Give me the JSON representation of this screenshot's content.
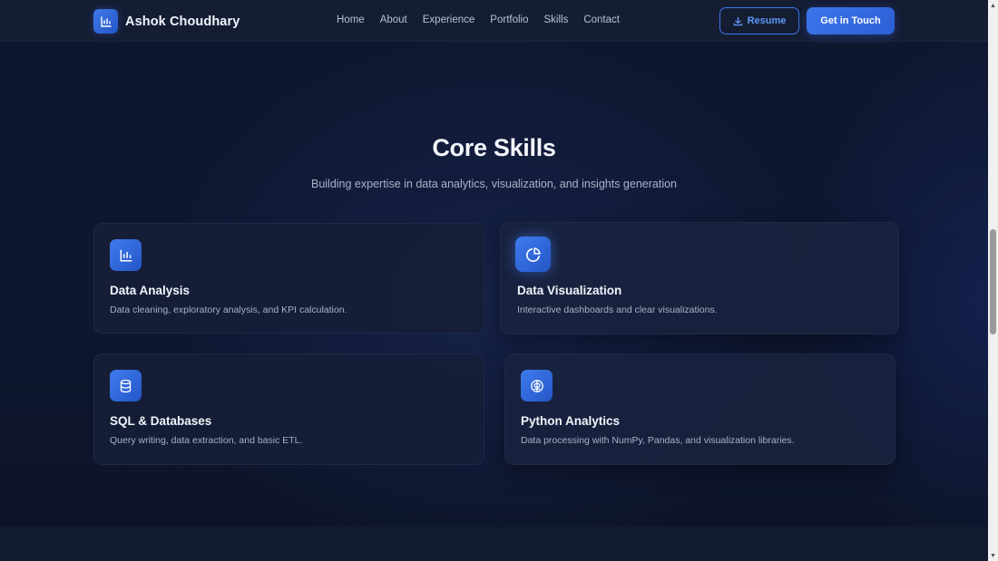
{
  "navbar": {
    "brand_name": "Ashok Choudhary",
    "links": [
      "Home",
      "About",
      "Experience",
      "Portfolio",
      "Skills",
      "Contact"
    ],
    "resume_label": "Resume",
    "touch_label": "Get in Touch"
  },
  "skills": {
    "title": "Core Skills",
    "subtitle": "Building expertise in data analytics, visualization, and insights generation",
    "cards": [
      {
        "title": "Data Analysis",
        "desc": "Data cleaning, exploratory analysis, and KPI calculation.",
        "icon": "bar-chart-icon"
      },
      {
        "title": "Data Visualization",
        "desc": "Interactive dashboards and clear visualizations.",
        "icon": "pie-chart-icon"
      },
      {
        "title": "SQL & Databases",
        "desc": "Query writing, data extraction, and basic ETL.",
        "icon": "database-icon"
      },
      {
        "title": "Python Analytics",
        "desc": "Data processing with NumPy, Pandas, and visualization libraries.",
        "icon": "brain-icon"
      }
    ]
  },
  "colors": {
    "accent": "#3d76ea",
    "background": "#0d1428",
    "card": "#161f38"
  }
}
